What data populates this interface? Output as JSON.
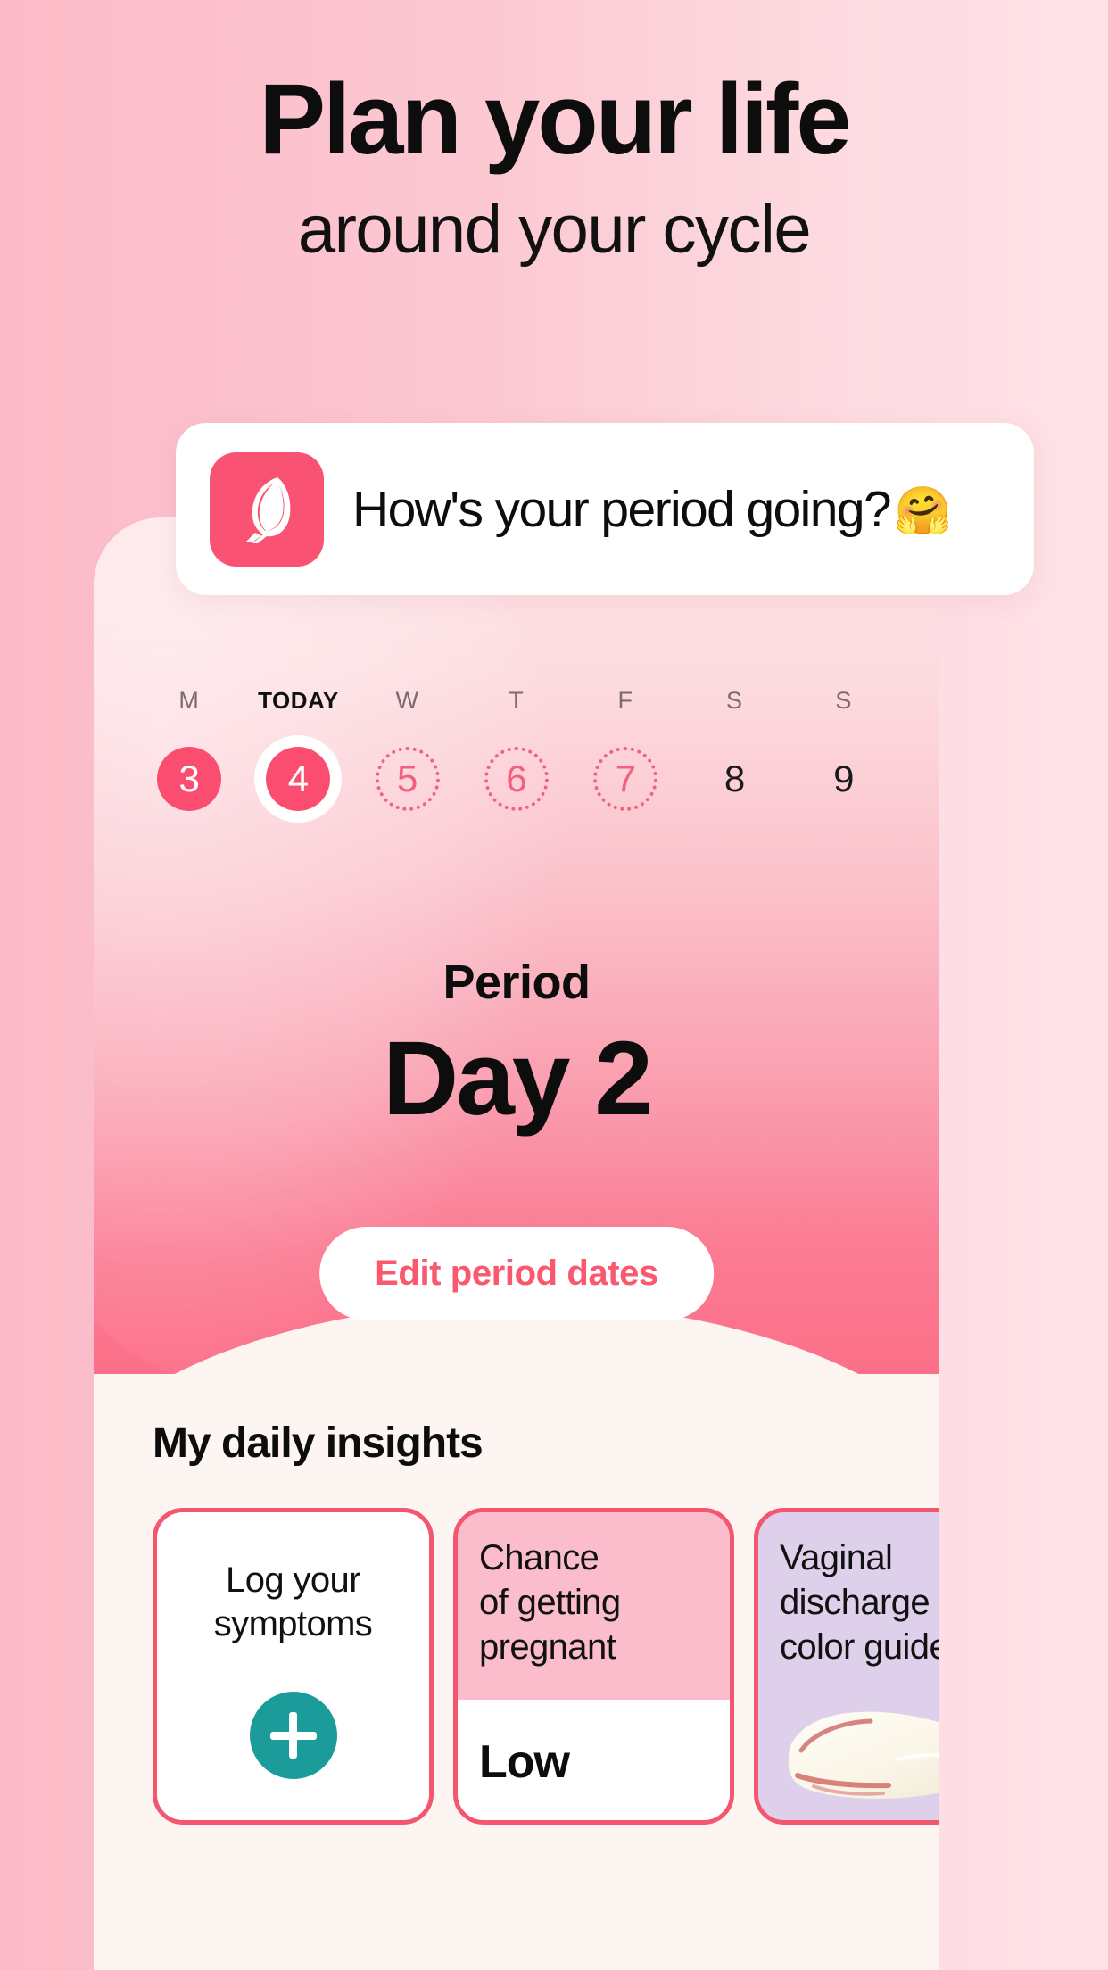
{
  "promo": {
    "headline": "Plan your life",
    "subhead": "around your cycle"
  },
  "notification": {
    "app_icon": "flo-feather-icon",
    "message": "How's your period going?",
    "emoji": "🤗"
  },
  "calendar": {
    "days": [
      {
        "letter": "M",
        "number": "3",
        "state": "filled",
        "is_today": false
      },
      {
        "letter": "TODAY",
        "number": "4",
        "state": "today-ring",
        "is_today": true
      },
      {
        "letter": "W",
        "number": "5",
        "state": "dotted",
        "is_today": false
      },
      {
        "letter": "T",
        "number": "6",
        "state": "dotted",
        "is_today": false
      },
      {
        "letter": "F",
        "number": "7",
        "state": "dotted",
        "is_today": false
      },
      {
        "letter": "S",
        "number": "8",
        "state": "plain",
        "is_today": false
      },
      {
        "letter": "S",
        "number": "9",
        "state": "plain",
        "is_today": false
      }
    ]
  },
  "cycle": {
    "status_label": "Period",
    "day_label": "Day 2",
    "edit_button": "Edit period dates"
  },
  "insights": {
    "title": "My daily insights",
    "cards": [
      {
        "id": "log-symptoms",
        "title": "Log your\nsymptoms",
        "icon": "plus-icon",
        "accent": "#1C9B9B"
      },
      {
        "id": "pregnancy-chance",
        "title": "Chance\nof getting\npregnant",
        "value": "Low",
        "header_bg": "#FBBDCB"
      },
      {
        "id": "discharge-guide",
        "title": "Vaginal\ndischarge\ncolor guide",
        "image": "discharge-smear-image",
        "card_bg": "#DED0EA"
      }
    ]
  },
  "colors": {
    "brand_pink": "#FA4D70",
    "card_border": "#F4556F",
    "teal": "#1C9B9B",
    "purple": "#DED0EA",
    "bg_left": "#FBBAC7",
    "bg_right": "#FEE2E7"
  }
}
